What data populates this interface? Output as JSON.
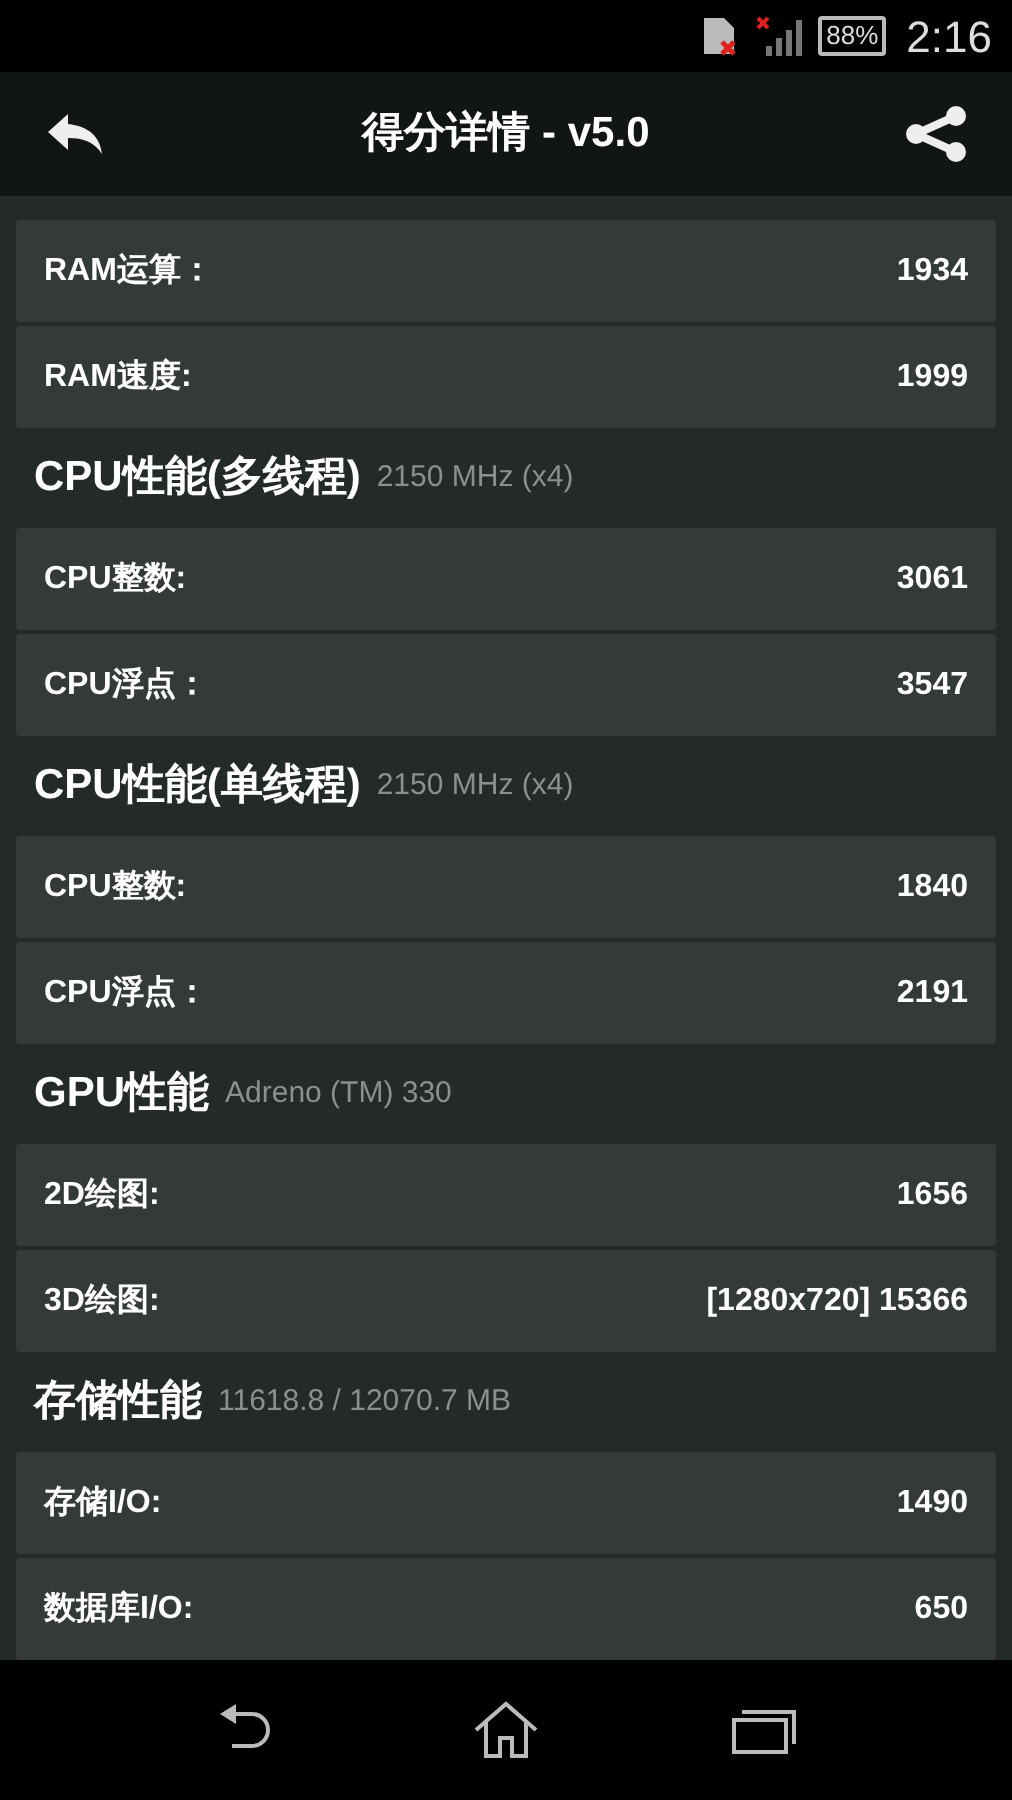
{
  "status_bar": {
    "battery": "88%",
    "time": "2:16"
  },
  "header": {
    "title": "得分详情 - v5.0"
  },
  "sections": [
    {
      "rows": [
        {
          "label": "RAM运算：",
          "value": "1934"
        },
        {
          "label": "RAM速度:",
          "value": "1999"
        }
      ]
    },
    {
      "title": "CPU性能(多线程)",
      "subtitle": "2150 MHz (x4)",
      "rows": [
        {
          "label": "CPU整数:",
          "value": "3061"
        },
        {
          "label": "CPU浮点：",
          "value": "3547"
        }
      ]
    },
    {
      "title": "CPU性能(单线程)",
      "subtitle": "2150 MHz (x4)",
      "rows": [
        {
          "label": "CPU整数:",
          "value": "1840"
        },
        {
          "label": "CPU浮点：",
          "value": "2191"
        }
      ]
    },
    {
      "title": "GPU性能",
      "subtitle": "Adreno (TM) 330",
      "rows": [
        {
          "label": "2D绘图:",
          "value": "1656"
        },
        {
          "label": "3D绘图:",
          "value": "[1280x720] 15366"
        }
      ]
    },
    {
      "title": "存储性能",
      "subtitle": "11618.8 / 12070.7 MB",
      "rows": [
        {
          "label": "存储I/O:",
          "value": "1490"
        },
        {
          "label": "数据库I/O:",
          "value": "650"
        }
      ]
    }
  ]
}
